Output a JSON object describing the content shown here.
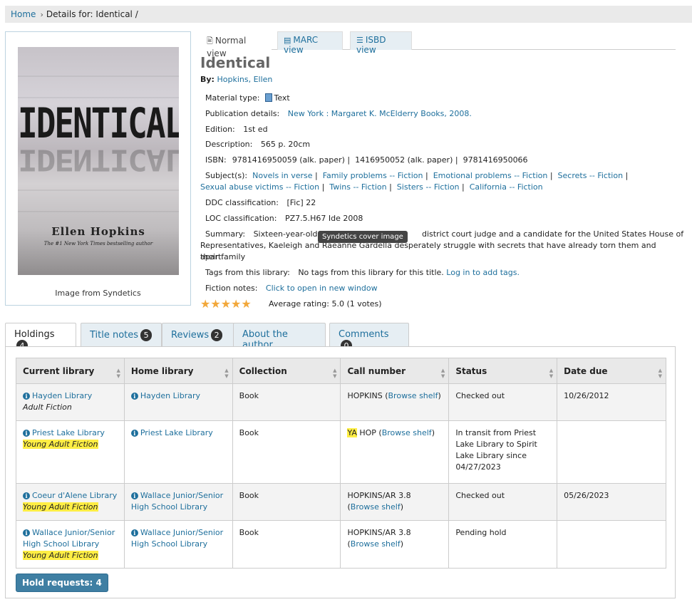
{
  "breadcrumb": {
    "home": "Home",
    "current": "Details for: Identical /"
  },
  "cover": {
    "title_art": "IDENTICAL",
    "author_art": "Ellen Hopkins",
    "tagline_art": "The #1 New York Times bestselling author",
    "caption": "Image from Syndetics",
    "tooltip": "Syndetics cover image"
  },
  "view_tabs": [
    {
      "label": "Normal view",
      "icon": "document-icon"
    },
    {
      "label": "MARC view",
      "icon": "card-icon"
    },
    {
      "label": "ISBD view",
      "icon": "list-icon"
    }
  ],
  "record": {
    "title": "Identical",
    "by_label": "By:",
    "author": "Hopkins, Ellen",
    "material_label": "Material type:",
    "material": "Text",
    "pub_label": "Publication details:",
    "pub": "New York : Margaret K. McElderry Books, 2008.",
    "edition_label": "Edition:",
    "edition": "1st ed",
    "desc_label": "Description:",
    "desc": "565 p. 20cm",
    "isbn_label": "ISBN:",
    "isbns": [
      "9781416950059 (alk. paper)",
      "1416950052 (alk. paper)",
      "9781416950066"
    ],
    "subjects_label": "Subject(s):",
    "subjects": [
      "Novels in verse",
      "Family problems -- Fiction",
      "Emotional problems -- Fiction",
      "Secrets -- Fiction",
      "Sexual abuse victims -- Fiction",
      "Twins -- Fiction",
      "Sisters -- Fiction",
      "California -- Fiction"
    ],
    "ddc_label": "DDC classification:",
    "ddc": "[Fic] 22",
    "loc_label": "LOC classification:",
    "loc": "PZ7.5.H67 Ide 2008",
    "summary_label": "Summary:",
    "summary_a": "Sixteen-year-old id",
    "summary_b": "district court judge and a candidate for the United States House of",
    "summary_c": "Representatives, Kaeleigh and Ra",
    "summary_d": "eanne Gardella desperately struggle with secrets that have already torn them and their family",
    "summary_e": "apart.",
    "tags_label": "Tags from this library:",
    "tags_text": "No tags from this library for this title.",
    "tags_link": "Log in to add tags.",
    "fiction_label": "Fiction notes:",
    "fiction_link": "Click to open in new window",
    "stars": "★★★★★",
    "rating_text": "Average rating: 5.0 (1 votes)",
    "rating_value": 5.0
  },
  "tabs": [
    {
      "label": "Holdings",
      "count": "4"
    },
    {
      "label": "Title notes",
      "count": "5"
    },
    {
      "label": "Reviews",
      "count": "2"
    },
    {
      "label": "About the author",
      "count": ""
    },
    {
      "label": "Comments",
      "count": "0"
    }
  ],
  "table": {
    "headers": [
      "Current library",
      "Home library",
      "Collection",
      "Call number",
      "Status",
      "Date due"
    ],
    "rows": [
      {
        "current": "Hayden Library",
        "collection_tag": "Adult Fiction",
        "home": "Hayden Library",
        "collection": "Book",
        "call_pre": "HOPKINS (",
        "browse": "Browse shelf",
        "call_post": ")",
        "status": "Checked out",
        "due": "10/26/2012"
      },
      {
        "current": "Priest Lake Library",
        "collection_tag": "Young Adult Fiction",
        "home": "Priest Lake Library",
        "collection": "Book",
        "call_hl": "YA",
        "call_pre": " HOP (",
        "browse": "Browse shelf",
        "call_post": ")",
        "status": "In transit from Priest Lake Library to Spirit Lake Library since 04/27/2023",
        "due": ""
      },
      {
        "current": "Coeur d'Alene Library",
        "collection_tag": "Young Adult Fiction",
        "home": "Wallace Junior/Senior High School Library",
        "collection": "Book",
        "call_pre": "HOPKINS/AR 3.8 (",
        "browse": "Browse shelf",
        "call_post": ")",
        "status": "Checked out",
        "due": "05/26/2023"
      },
      {
        "current": "Wallace Junior/Senior High School Library",
        "collection_tag": "Young Adult Fiction",
        "home": "Wallace Junior/Senior High School Library",
        "collection": "Book",
        "call_pre": "HOPKINS/AR 3.8 (",
        "browse": "Browse shelf",
        "call_post": ")",
        "status": "Pending hold",
        "due": ""
      }
    ]
  },
  "hold_button": "Hold requests: 4"
}
